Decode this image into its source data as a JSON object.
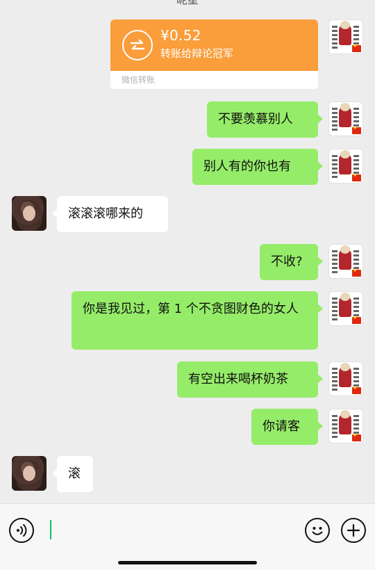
{
  "header": {
    "title_fragment": "昵星"
  },
  "transfer": {
    "amount": "¥0.52",
    "to_label": "转账给辩论冠军",
    "brand_label": "微信转账"
  },
  "messages": [
    {
      "from": "me",
      "text": "不要羡慕别人"
    },
    {
      "from": "me",
      "text": "别人有的你也有"
    },
    {
      "from": "other",
      "text": "滚滚滚哪来的"
    },
    {
      "from": "me",
      "text": "不收?"
    },
    {
      "from": "me",
      "text": "你是我见过，第 1 个不贪图财色的女人"
    },
    {
      "from": "me",
      "text": "有空出来喝杯奶茶"
    },
    {
      "from": "me",
      "text": "你请客"
    },
    {
      "from": "other",
      "text": "滚"
    }
  ],
  "input_bar": {
    "voice_icon": "voice-icon",
    "emoji_icon": "emoji-icon",
    "plus_icon": "plus-icon",
    "text_value": ""
  },
  "colors": {
    "sent_bubble": "#95ec69",
    "received_bubble": "#ffffff",
    "transfer_orange": "#fa9d3b",
    "background": "#ededed",
    "caret": "#07c160"
  }
}
